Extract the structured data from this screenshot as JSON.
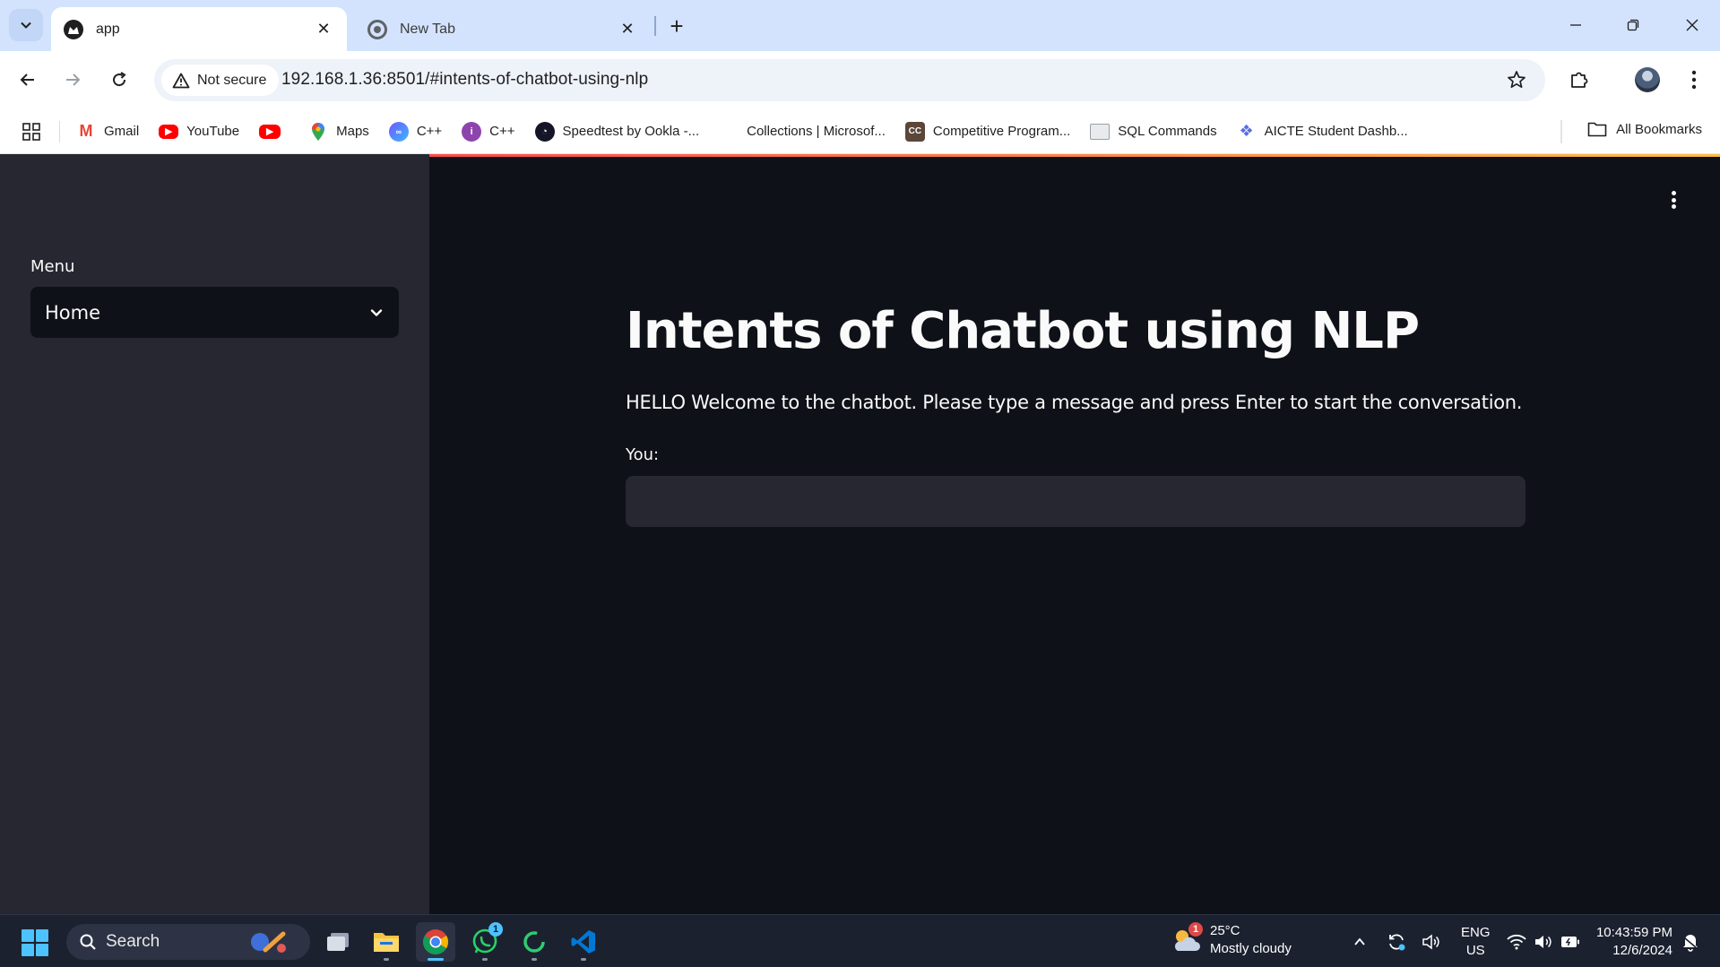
{
  "browser": {
    "tabs": [
      {
        "title": "app",
        "active": true
      },
      {
        "title": "New Tab",
        "active": false
      }
    ],
    "security_label": "Not secure",
    "url": "192.168.1.36:8501/#intents-of-chatbot-using-nlp",
    "bookmarks": [
      {
        "label": "Gmail",
        "icon": "gmail-icon",
        "color": "#ea4335"
      },
      {
        "label": "YouTube",
        "icon": "youtube-icon",
        "color": "#ff0000"
      },
      {
        "label": "",
        "icon": "youtube-icon",
        "color": "#ff0000"
      },
      {
        "label": "Maps",
        "icon": "maps-pin-icon",
        "color": "#34a853"
      },
      {
        "label": "C++",
        "icon": "cpp-icon",
        "color": "#7b61ff"
      },
      {
        "label": "C++",
        "icon": "cpp-icon",
        "color": "#8e44ad"
      },
      {
        "label": "Speedtest by Ookla -...",
        "icon": "speedtest-icon",
        "color": "#141526"
      },
      {
        "label": "Collections | Microsof...",
        "icon": "microsoft-icon",
        "color": "#f25022"
      },
      {
        "label": "Competitive Program...",
        "icon": "codechef-icon",
        "color": "#5b4638"
      },
      {
        "label": "SQL Commands",
        "icon": "sql-icon",
        "color": "#9aa0a6"
      },
      {
        "label": "AICTE Student Dashb...",
        "icon": "aicte-icon",
        "color": "#5b6ee1"
      }
    ],
    "all_bookmarks_label": "All Bookmarks"
  },
  "sidebar": {
    "menu_label": "Menu",
    "menu_selected": "Home"
  },
  "main": {
    "title": "Intents of Chatbot using NLP",
    "intro": "HELLO Welcome to the chatbot. Please type a message and press Enter to start the conversation.",
    "input_label": "You:",
    "input_value": ""
  },
  "taskbar": {
    "search_placeholder": "Search",
    "whatsapp_badge": "1",
    "weather": {
      "temp": "25°C",
      "condition": "Mostly cloudy",
      "badge": "1"
    },
    "language": {
      "lang": "ENG",
      "region": "US"
    },
    "clock": {
      "time": "10:43:59 PM",
      "date": "12/6/2024"
    }
  },
  "colors": {
    "app_bg": "#0e1117",
    "sidebar_bg": "#262730",
    "accent_gradient_start": "#ff4b4b",
    "accent_gradient_end": "#ffbd45",
    "tabstrip_bg": "#d3e3fd"
  }
}
